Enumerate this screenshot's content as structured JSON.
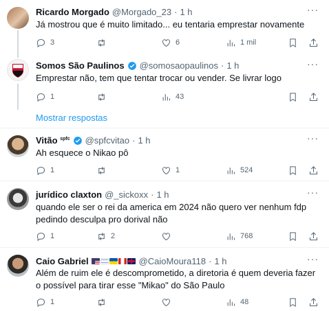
{
  "tweets": [
    {
      "name": "Ricardo Morgado",
      "handle": "@Morgado_23",
      "time": "1 h",
      "text": "Já mostrou que é muito limitado... eu tentaria emprestar novamente",
      "replies": "3",
      "retweets": "",
      "likes": "6",
      "views": "1 mil"
    },
    {
      "name": "Somos São Paulinos",
      "handle": "@somosaopaulinos",
      "time": "1 h",
      "text": "Emprestar não, tem que tentar trocar ou vender. Se livrar logo",
      "replies": "1",
      "retweets": "",
      "likes": "",
      "views": "43"
    },
    {
      "name": "Vitão",
      "name_sup": "spfc",
      "handle": "@spfcvitao",
      "time": "1 h",
      "text": "Ah esquece o Nikao pô",
      "replies": "1",
      "retweets": "",
      "likes": "1",
      "views": "524"
    },
    {
      "name": "jurídico claxton",
      "handle": "@_sickoxx",
      "time": "1 h",
      "text": "quando ele ser o rei da america em 2024 não quero ver nenhum fdp pedindo desculpa pro dorival não",
      "replies": "1",
      "retweets": "2",
      "likes": "",
      "views": "768"
    },
    {
      "name": "Caio Gabriel",
      "handle": "@CaioMoura118",
      "time": "1 h",
      "text": "Além de ruim ele é descomprometido, a diretoria é quem deveria fazer o possível para tirar esse \"Mikao\" do São Paulo",
      "replies": "1",
      "retweets": "",
      "likes": "",
      "views": "48"
    }
  ],
  "dot": "·",
  "more_label": "···",
  "show_replies": "Mostrar respostas",
  "colors": {
    "accent": "#1d9bf0",
    "muted": "#536471",
    "divider": "#eff3f4"
  },
  "icons": [
    "reply-icon",
    "retweet-icon",
    "like-icon",
    "views-icon",
    "bookmark-icon",
    "share-icon",
    "verified-icon",
    "more-icon"
  ]
}
